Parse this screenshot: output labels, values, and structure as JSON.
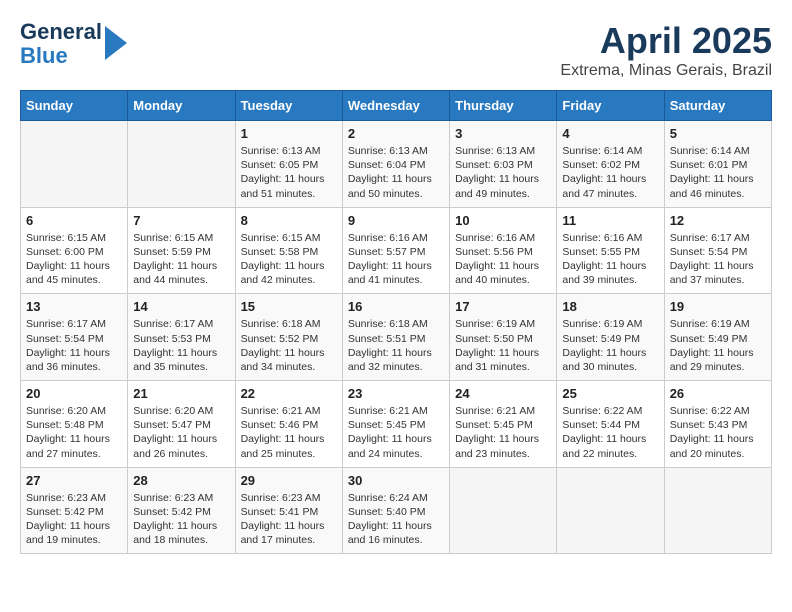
{
  "header": {
    "logo_line1": "General",
    "logo_line2": "Blue",
    "month": "April 2025",
    "location": "Extrema, Minas Gerais, Brazil"
  },
  "weekdays": [
    "Sunday",
    "Monday",
    "Tuesday",
    "Wednesday",
    "Thursday",
    "Friday",
    "Saturday"
  ],
  "weeks": [
    [
      {
        "day": "",
        "detail": ""
      },
      {
        "day": "",
        "detail": ""
      },
      {
        "day": "1",
        "detail": "Sunrise: 6:13 AM\nSunset: 6:05 PM\nDaylight: 11 hours and 51 minutes."
      },
      {
        "day": "2",
        "detail": "Sunrise: 6:13 AM\nSunset: 6:04 PM\nDaylight: 11 hours and 50 minutes."
      },
      {
        "day": "3",
        "detail": "Sunrise: 6:13 AM\nSunset: 6:03 PM\nDaylight: 11 hours and 49 minutes."
      },
      {
        "day": "4",
        "detail": "Sunrise: 6:14 AM\nSunset: 6:02 PM\nDaylight: 11 hours and 47 minutes."
      },
      {
        "day": "5",
        "detail": "Sunrise: 6:14 AM\nSunset: 6:01 PM\nDaylight: 11 hours and 46 minutes."
      }
    ],
    [
      {
        "day": "6",
        "detail": "Sunrise: 6:15 AM\nSunset: 6:00 PM\nDaylight: 11 hours and 45 minutes."
      },
      {
        "day": "7",
        "detail": "Sunrise: 6:15 AM\nSunset: 5:59 PM\nDaylight: 11 hours and 44 minutes."
      },
      {
        "day": "8",
        "detail": "Sunrise: 6:15 AM\nSunset: 5:58 PM\nDaylight: 11 hours and 42 minutes."
      },
      {
        "day": "9",
        "detail": "Sunrise: 6:16 AM\nSunset: 5:57 PM\nDaylight: 11 hours and 41 minutes."
      },
      {
        "day": "10",
        "detail": "Sunrise: 6:16 AM\nSunset: 5:56 PM\nDaylight: 11 hours and 40 minutes."
      },
      {
        "day": "11",
        "detail": "Sunrise: 6:16 AM\nSunset: 5:55 PM\nDaylight: 11 hours and 39 minutes."
      },
      {
        "day": "12",
        "detail": "Sunrise: 6:17 AM\nSunset: 5:54 PM\nDaylight: 11 hours and 37 minutes."
      }
    ],
    [
      {
        "day": "13",
        "detail": "Sunrise: 6:17 AM\nSunset: 5:54 PM\nDaylight: 11 hours and 36 minutes."
      },
      {
        "day": "14",
        "detail": "Sunrise: 6:17 AM\nSunset: 5:53 PM\nDaylight: 11 hours and 35 minutes."
      },
      {
        "day": "15",
        "detail": "Sunrise: 6:18 AM\nSunset: 5:52 PM\nDaylight: 11 hours and 34 minutes."
      },
      {
        "day": "16",
        "detail": "Sunrise: 6:18 AM\nSunset: 5:51 PM\nDaylight: 11 hours and 32 minutes."
      },
      {
        "day": "17",
        "detail": "Sunrise: 6:19 AM\nSunset: 5:50 PM\nDaylight: 11 hours and 31 minutes."
      },
      {
        "day": "18",
        "detail": "Sunrise: 6:19 AM\nSunset: 5:49 PM\nDaylight: 11 hours and 30 minutes."
      },
      {
        "day": "19",
        "detail": "Sunrise: 6:19 AM\nSunset: 5:49 PM\nDaylight: 11 hours and 29 minutes."
      }
    ],
    [
      {
        "day": "20",
        "detail": "Sunrise: 6:20 AM\nSunset: 5:48 PM\nDaylight: 11 hours and 27 minutes."
      },
      {
        "day": "21",
        "detail": "Sunrise: 6:20 AM\nSunset: 5:47 PM\nDaylight: 11 hours and 26 minutes."
      },
      {
        "day": "22",
        "detail": "Sunrise: 6:21 AM\nSunset: 5:46 PM\nDaylight: 11 hours and 25 minutes."
      },
      {
        "day": "23",
        "detail": "Sunrise: 6:21 AM\nSunset: 5:45 PM\nDaylight: 11 hours and 24 minutes."
      },
      {
        "day": "24",
        "detail": "Sunrise: 6:21 AM\nSunset: 5:45 PM\nDaylight: 11 hours and 23 minutes."
      },
      {
        "day": "25",
        "detail": "Sunrise: 6:22 AM\nSunset: 5:44 PM\nDaylight: 11 hours and 22 minutes."
      },
      {
        "day": "26",
        "detail": "Sunrise: 6:22 AM\nSunset: 5:43 PM\nDaylight: 11 hours and 20 minutes."
      }
    ],
    [
      {
        "day": "27",
        "detail": "Sunrise: 6:23 AM\nSunset: 5:42 PM\nDaylight: 11 hours and 19 minutes."
      },
      {
        "day": "28",
        "detail": "Sunrise: 6:23 AM\nSunset: 5:42 PM\nDaylight: 11 hours and 18 minutes."
      },
      {
        "day": "29",
        "detail": "Sunrise: 6:23 AM\nSunset: 5:41 PM\nDaylight: 11 hours and 17 minutes."
      },
      {
        "day": "30",
        "detail": "Sunrise: 6:24 AM\nSunset: 5:40 PM\nDaylight: 11 hours and 16 minutes."
      },
      {
        "day": "",
        "detail": ""
      },
      {
        "day": "",
        "detail": ""
      },
      {
        "day": "",
        "detail": ""
      }
    ]
  ]
}
